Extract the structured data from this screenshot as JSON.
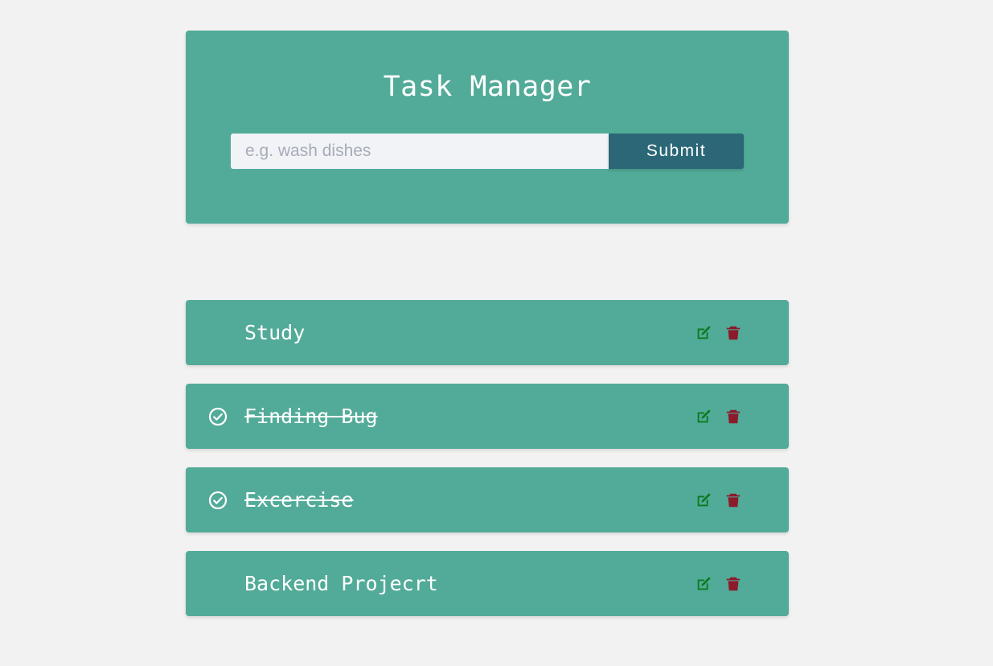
{
  "header": {
    "title": "Task Manager",
    "input_placeholder": "e.g. wash dishes",
    "input_value": "",
    "submit_label": "Submit"
  },
  "colors": {
    "page_background": "#f2f2f2",
    "card": "#52ab98",
    "submit_button": "#2b6777",
    "edit_icon": "#0a7a1e",
    "delete_icon": "#8b1a2b",
    "text": "#ffffff"
  },
  "tasks": [
    {
      "label": "Study",
      "completed": false,
      "icons": [
        "edit-icon",
        "trash-icon"
      ]
    },
    {
      "label": "Finding Bug",
      "completed": true,
      "icons": [
        "check-circle-icon",
        "edit-icon",
        "trash-icon"
      ]
    },
    {
      "label": "Excercise",
      "completed": true,
      "icons": [
        "check-circle-icon",
        "edit-icon",
        "trash-icon"
      ]
    },
    {
      "label": "Backend Projecrt",
      "completed": false,
      "icons": [
        "edit-icon",
        "trash-icon"
      ]
    }
  ]
}
